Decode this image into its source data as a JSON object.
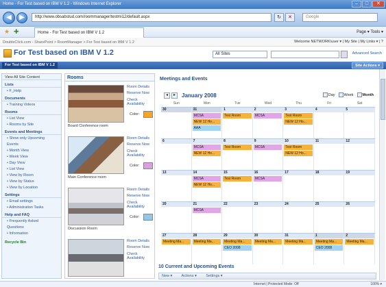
{
  "window": {
    "title": "Home - For Test based on IBM V 1.2 - Windows Internet Explorer",
    "minimize": "–",
    "maximize": "□",
    "close": "✕"
  },
  "browser": {
    "url": "http://www.obsabstud.com/roommanager/testmi12/default.aspx",
    "search_placeholder": "Google",
    "tab_label": "Home - For Test based on IBM V 1.2",
    "tools_label": "Page ▾  Tools ▾"
  },
  "sharepoint": {
    "breadcrumb": "DoubleClick.com - SharePoint > RoomManager > For Test based on IBM V 1.2",
    "welcome": "Welcome NETWORK\\user ▾ | My Site | My Links ▾ | ?",
    "site_title": "For Test based on IBM V 1.2",
    "scope_label": "All Sites",
    "advanced_search": "Advanced Search",
    "top_nav_current": "For Test based on IBM V 1.2",
    "site_actions": "Site Actions ▾"
  },
  "leftnav": {
    "view_all": "View All Site Content",
    "items": [
      {
        "label": "Lists",
        "kind": "h"
      },
      {
        "label": "• F_Help",
        "kind": "i"
      },
      {
        "label": "Documents",
        "kind": "h"
      },
      {
        "label": "• Training Videos",
        "kind": "i"
      },
      {
        "label": "Rooms",
        "kind": "h"
      },
      {
        "label": "• List View",
        "kind": "i"
      },
      {
        "label": "• Rooms by Site",
        "kind": "i"
      },
      {
        "label": "Events and Meetings",
        "kind": "h"
      },
      {
        "label": "• Show only Upcoming",
        "kind": "i"
      },
      {
        "label": "  Events",
        "kind": "i"
      },
      {
        "label": "• Month View",
        "kind": "i"
      },
      {
        "label": "• Week View",
        "kind": "i"
      },
      {
        "label": "• Day View",
        "kind": "i"
      },
      {
        "label": "• List View",
        "kind": "i"
      },
      {
        "label": "• View by Room",
        "kind": "i"
      },
      {
        "label": "• View by Status",
        "kind": "i"
      },
      {
        "label": "• View by Location",
        "kind": "i"
      },
      {
        "label": "Settings",
        "kind": "h"
      },
      {
        "label": "• Email settings",
        "kind": "i"
      },
      {
        "label": "• Administration Tasks",
        "kind": "i"
      },
      {
        "label": "Help and FAQ",
        "kind": "h"
      },
      {
        "label": "• Frequently Asked",
        "kind": "i"
      },
      {
        "label": "  Questions",
        "kind": "i"
      },
      {
        "label": "• Information",
        "kind": "i"
      }
    ],
    "recycle_bin": "Recycle Bin"
  },
  "rooms": {
    "title": "Rooms",
    "room_details": "Room Details",
    "reserve_now": "Reserve Now",
    "check": "Check",
    "availability": "Availability",
    "color_label": "Color:",
    "list": [
      {
        "name": "Board Conference room",
        "color": "#f5a623"
      },
      {
        "name": "Main Conference room",
        "color": "#d9a0e0"
      },
      {
        "name": "Discussion Room",
        "color": "#8ec9ea"
      },
      {
        "name": "",
        "color": ""
      }
    ]
  },
  "calendar": {
    "title": "Meetings and Events",
    "month": "January 2008",
    "views": {
      "day": "Day",
      "week": "Week",
      "month": "Month"
    },
    "dow": [
      "Sun",
      "Mon",
      "Tue",
      "Wed",
      "Thu",
      "Fri",
      "Sat"
    ],
    "colors": {
      "mcsa": "#e2a6e8",
      "orange": "#f7b23b",
      "blue": "#9fd4f2"
    },
    "weeks": [
      [
        {
          "d": "30",
          "om": true
        },
        {
          "d": "31",
          "om": true,
          "ev": [
            [
              "MCSA",
              "mcsa"
            ],
            [
              "NEW 12 Ho...",
              "orange"
            ],
            [
              "AAA",
              "blue"
            ]
          ]
        },
        {
          "d": "1",
          "ev": [
            [
              "Test Room",
              "orange"
            ]
          ]
        },
        {
          "d": "2",
          "ev": [
            [
              "MCSA",
              "mcsa"
            ]
          ]
        },
        {
          "d": "3",
          "ev": [
            [
              "Test Room",
              "orange"
            ],
            [
              "NEW 12 Ho...",
              "orange"
            ]
          ]
        },
        {
          "d": "4"
        },
        {
          "d": "5"
        }
      ],
      [
        {
          "d": "6"
        },
        {
          "d": "7",
          "ev": [
            [
              "MCSA",
              "mcsa"
            ],
            [
              "NEW 12 Ho...",
              "orange"
            ]
          ]
        },
        {
          "d": "8",
          "ev": [
            [
              "Test Room",
              "orange"
            ]
          ]
        },
        {
          "d": "9",
          "ev": [
            [
              "MCSA",
              "mcsa"
            ]
          ]
        },
        {
          "d": "10",
          "ev": [
            [
              "Test Room",
              "orange"
            ],
            [
              "NEW 12 Ho...",
              "orange"
            ]
          ]
        },
        {
          "d": "11"
        },
        {
          "d": "12"
        }
      ],
      [
        {
          "d": "13"
        },
        {
          "d": "14",
          "ev": [
            [
              "MCSA",
              "mcsa"
            ],
            [
              "NEW 12 Ho...",
              "orange"
            ]
          ]
        },
        {
          "d": "15",
          "ev": [
            [
              "Test Room",
              "orange"
            ]
          ]
        },
        {
          "d": "16",
          "ev": [
            [
              "MCSA",
              "mcsa"
            ]
          ]
        },
        {
          "d": "17"
        },
        {
          "d": "18"
        },
        {
          "d": "19"
        }
      ],
      [
        {
          "d": "20"
        },
        {
          "d": "21",
          "ev": [
            [
              "MCSA",
              "mcsa"
            ]
          ]
        },
        {
          "d": "22"
        },
        {
          "d": "23"
        },
        {
          "d": "24"
        },
        {
          "d": "25"
        },
        {
          "d": "26"
        }
      ],
      [
        {
          "d": "27",
          "ev": [
            [
              "Meeting Ma...",
              "orange"
            ]
          ]
        },
        {
          "d": "28",
          "ev": [
            [
              "Meeting Ma...",
              "orange"
            ]
          ]
        },
        {
          "d": "29",
          "ev": [
            [
              "Meeting Ma...",
              "orange"
            ],
            [
              "CEO 2008",
              "blue"
            ]
          ]
        },
        {
          "d": "30",
          "ev": [
            [
              "Meeting Ma...",
              "orange"
            ]
          ]
        },
        {
          "d": "31",
          "ev": [
            [
              "Meeting Ma...",
              "orange"
            ]
          ]
        },
        {
          "d": "1",
          "om": true,
          "ev": [
            [
              "Meeting Ma...",
              "orange"
            ],
            [
              "CEO 2008",
              "blue"
            ]
          ]
        },
        {
          "d": "2",
          "om": true,
          "ev": [
            [
              "Meeting Ma...",
              "orange"
            ]
          ]
        }
      ]
    ]
  },
  "upcoming": {
    "title": "10 Current and Upcoming Events",
    "new": "New ▾",
    "actions": "Actions ▾",
    "settings": "Settings ▾"
  },
  "status": {
    "zone": "Internet | Protected Mode: Off",
    "zoom": "100% ▾"
  }
}
